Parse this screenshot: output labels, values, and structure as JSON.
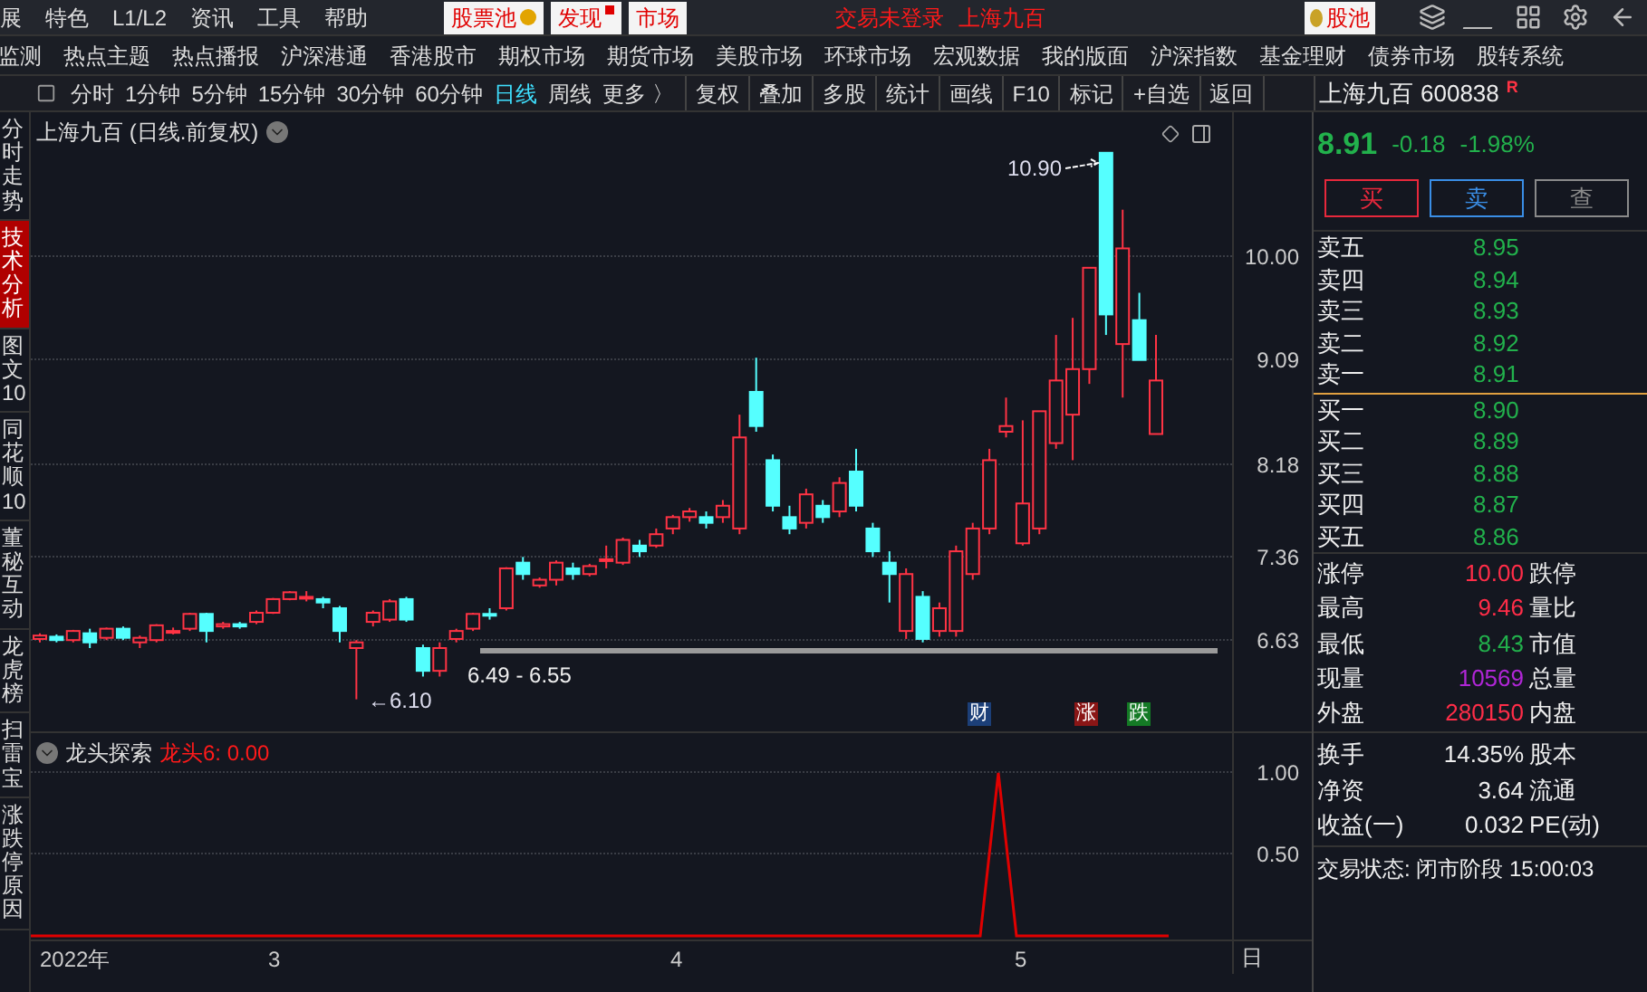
{
  "menu": [
    {
      "label": "展"
    },
    {
      "label": "特色"
    },
    {
      "label": "L1/L2"
    },
    {
      "label": "资讯"
    },
    {
      "label": "工具"
    },
    {
      "label": "帮助"
    }
  ],
  "top_tabs": [
    {
      "label": "股票池",
      "kind": "coin"
    },
    {
      "label": "发现",
      "kind": "dot"
    },
    {
      "label": "市场",
      "kind": "plain"
    }
  ],
  "status_texts": [
    "交易未登录",
    "上海九百"
  ],
  "pool_button": {
    "label": "股池"
  },
  "nav": [
    "监测",
    "热点主题",
    "热点播报",
    "沪深港通",
    "香港股市",
    "期权市场",
    "期货市场",
    "美股市场",
    "环球市场",
    "宏观数据",
    "我的版面",
    "沪深指数",
    "基金理财",
    "债券市场",
    "股转系统"
  ],
  "periods": [
    {
      "label": "分时",
      "selected": false
    },
    {
      "label": "1分钟",
      "selected": false
    },
    {
      "label": "5分钟",
      "selected": false
    },
    {
      "label": "15分钟",
      "selected": false
    },
    {
      "label": "30分钟",
      "selected": false
    },
    {
      "label": "60分钟",
      "selected": false
    },
    {
      "label": "日线",
      "selected": true
    },
    {
      "label": "周线",
      "selected": false
    },
    {
      "label": "更多 〉",
      "selected": false
    }
  ],
  "tools": [
    "复权",
    "叠加",
    "多股",
    "统计",
    "画线",
    "F10",
    "标记",
    "+自选",
    "返回"
  ],
  "quote_header": {
    "name": "上海九百",
    "code": "600838",
    "badge": "R"
  },
  "vertical_tabs": [
    {
      "label": "分时走势",
      "selected": false
    },
    {
      "label": "技术分析",
      "selected": true
    },
    {
      "label": "图文10",
      "selected": false
    },
    {
      "label": "同花顺10",
      "selected": false
    },
    {
      "label": "董秘互动",
      "selected": false
    },
    {
      "label": "龙虎榜",
      "selected": false
    },
    {
      "label": "扫雷宝",
      "selected": false
    },
    {
      "label": "涨跌停原因",
      "selected": false
    }
  ],
  "chart": {
    "title": "上海九百 (日线.前复权)",
    "y_labels": [
      "10.00",
      "9.09",
      "8.18",
      "7.36",
      "6.63"
    ],
    "high_label": "10.90",
    "low_label": "←6.10",
    "range_label": "6.49 - 6.55",
    "events": [
      {
        "label": "财",
        "color": "#1c3f78"
      },
      {
        "label": "涨",
        "color": "#8a1616"
      },
      {
        "label": "跌",
        "color": "#147a25"
      }
    ]
  },
  "indicator": {
    "name": "龙头探索",
    "value": "龙头6: 0.00",
    "y_labels": [
      "1.00",
      "0.50"
    ]
  },
  "x_axis": {
    "labels": [
      "2022年",
      "3",
      "4",
      "5"
    ],
    "unit": "日"
  },
  "quote": {
    "price": "8.91",
    "change": "-0.18",
    "percent": "-1.98%",
    "actions": [
      {
        "label": "买",
        "color": "#e8283c"
      },
      {
        "label": "卖",
        "color": "#3a8ee6"
      },
      {
        "label": "查",
        "color": "#8a8a8a"
      }
    ],
    "asks": [
      {
        "label": "卖五",
        "price": "8.95"
      },
      {
        "label": "卖四",
        "price": "8.94"
      },
      {
        "label": "卖三",
        "price": "8.93"
      },
      {
        "label": "卖二",
        "price": "8.92"
      },
      {
        "label": "卖一",
        "price": "8.91"
      }
    ],
    "bids": [
      {
        "label": "买一",
        "price": "8.90"
      },
      {
        "label": "买二",
        "price": "8.89"
      },
      {
        "label": "买三",
        "price": "8.88"
      },
      {
        "label": "买四",
        "price": "8.87"
      },
      {
        "label": "买五",
        "price": "8.86"
      }
    ],
    "stats": [
      {
        "label": "涨停",
        "value": "10.00",
        "color": "#ff2d48",
        "label2": "跌停"
      },
      {
        "label": "最高",
        "value": "9.46",
        "color": "#ff2d48",
        "label2": "量比"
      },
      {
        "label": "最低",
        "value": "8.43",
        "color": "#22b14c",
        "label2": "市值"
      },
      {
        "label": "现量",
        "value": "10569",
        "color": "#b026d6",
        "label2": "总量"
      },
      {
        "label": "外盘",
        "value": "280150",
        "color": "#ff2d48",
        "label2": "内盘"
      }
    ],
    "stats2": [
      {
        "label": "换手",
        "value": "14.35%",
        "label2": "股本"
      },
      {
        "label": "净资",
        "value": "3.64",
        "label2": "流通"
      },
      {
        "label": "收益(一)",
        "value": "0.032",
        "label2": "PE(动)"
      }
    ],
    "trade_status": "交易状态: 闭市阶段 15:00:03"
  }
}
